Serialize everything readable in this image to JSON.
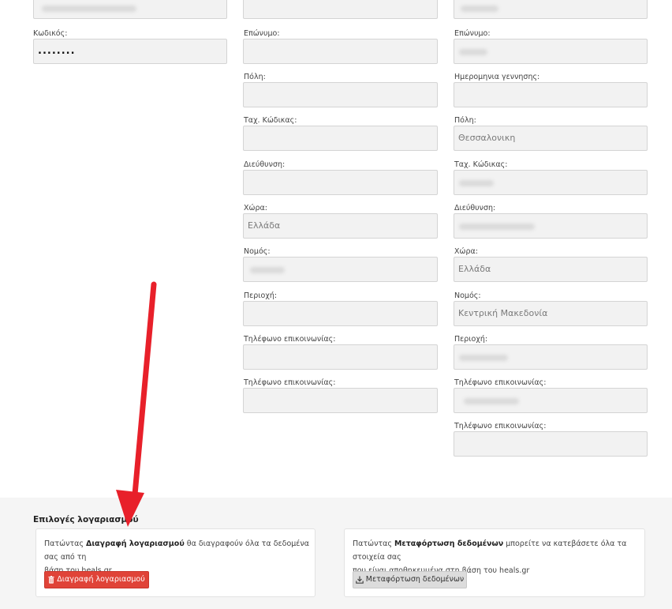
{
  "column1": {
    "password_label": "Κωδικός:",
    "password_value": "........"
  },
  "column2": {
    "fields": [
      {
        "label": "Επώνυμο:",
        "value": ""
      },
      {
        "label": "Πόλη:",
        "value": ""
      },
      {
        "label": "Ταχ. Κώδικας:",
        "value": ""
      },
      {
        "label": "Διεύθυνση:",
        "value": ""
      },
      {
        "label": "Χώρα:",
        "value": "Ελλάδα"
      },
      {
        "label": "Νομός:",
        "value": ""
      },
      {
        "label": "Περιοχή:",
        "value": ""
      },
      {
        "label": "Τηλέφωνο επικοινωνίας:",
        "value": ""
      },
      {
        "label": "Τηλέφωνο επικοινωνίας:",
        "value": ""
      }
    ]
  },
  "column3": {
    "fields": [
      {
        "label": "Επώνυμο:",
        "value": ""
      },
      {
        "label": "Ημερομηνια γεννησης:",
        "value": ""
      },
      {
        "label": "Πόλη:",
        "value": "Θεσσαλονικη"
      },
      {
        "label": "Ταχ. Κώδικας:",
        "value": ""
      },
      {
        "label": "Διεύθυνση:",
        "value": ""
      },
      {
        "label": "Χώρα:",
        "value": "Ελλάδα"
      },
      {
        "label": "Νομός:",
        "value": "Κεντρική Μακεδονία"
      },
      {
        "label": "Περιοχή:",
        "value": ""
      },
      {
        "label": "Τηλέφωνο επικοινωνίας:",
        "value": ""
      },
      {
        "label": "Τηλέφωνο επικοινωνίας:",
        "value": ""
      }
    ]
  },
  "account_options": {
    "title": "Επιλογές λογαριασμού",
    "delete_card": {
      "text_prefix": "Πατώντας ",
      "text_bold": "Διαγραφή λογαριασμού",
      "text_line1_suffix": " θα διαγραφούν όλα τα δεδομένα σας από τη",
      "text_line2": "βάση του heals.gr",
      "button_label": "Διαγραφή λογαριασμού",
      "button_icon": "trash-icon"
    },
    "export_card": {
      "text_prefix": "Πατώντας ",
      "text_bold": "Μεταφόρτωση δεδομένων",
      "text_line1_suffix": " μπορείτε να κατεβάσετε όλα τα στοιχεία σας",
      "text_line2": "που είναι αποθηκευμένα στη βάση του heals.gr",
      "button_label": "Μεταφόρτωση δεδομένων",
      "button_icon": "download-icon"
    }
  },
  "colors": {
    "danger": "#e04338",
    "arrow": "#e8202a",
    "input_bg": "#f2f2f2"
  }
}
